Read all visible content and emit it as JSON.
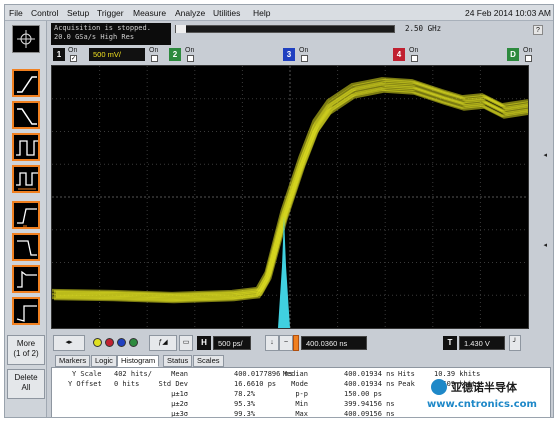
{
  "menu": [
    "File",
    "Control",
    "Setup",
    "Trigger",
    "Measure",
    "Analyze",
    "Utilities",
    "Help"
  ],
  "datetime": "24 Feb 2014 10:03 AM",
  "acquisition": {
    "status": "Acquisition is stopped.",
    "rate": "20.0 GSa/s   High Res"
  },
  "bandwidth": "2.50 GHz",
  "help": "?",
  "channels": {
    "ch1": {
      "num": "1",
      "on": "On",
      "scale": "500 mV/",
      "color": "#e8e020"
    },
    "ch2": {
      "num": "2",
      "on": "On",
      "color": "#30a040"
    },
    "ch3": {
      "num": "3",
      "on": "On",
      "color": "#2040c0"
    },
    "ch4": {
      "num": "4",
      "on": "On",
      "color": "#c02030"
    },
    "d": {
      "num": "D",
      "on": "On",
      "color": "#30a040"
    }
  },
  "left_toolbar": {
    "more": "More\n(1 of 2)",
    "delete": "Delete\nAll"
  },
  "timebase": {
    "h_label": "H",
    "h_value": "500 ps/",
    "delay_value": "400.0360 ns",
    "t_label": "T",
    "t_value": "1.430 V"
  },
  "tabs": [
    "Markers",
    "Logic",
    "Histogram",
    "Status",
    "Scales"
  ],
  "active_tab": "Histogram",
  "histogram": {
    "y_scale_label": "Y Scale",
    "y_scale_value": "402 hits/",
    "y_offset_label": "Y Offset",
    "y_offset_value": "0 hits",
    "rows": [
      {
        "label": "Mean",
        "value": "400.0177896 ns",
        "label2": "Median",
        "value2": "400.01934 ns",
        "label3": "Hits",
        "value3": "10.39 khits"
      },
      {
        "label": "Std Dev",
        "value": "16.6610 ps",
        "label2": "Mode",
        "value2": "400.01934 ns",
        "label3": "Peak",
        "value3": "1.609 khits"
      },
      {
        "label": "μ±1σ",
        "value": "78.2%",
        "label2": "p-p",
        "value2": "150.00 ps"
      },
      {
        "label": "μ±2σ",
        "value": "95.3%",
        "label2": "Min",
        "value2": "399.94156 ns"
      },
      {
        "label": "μ±3σ",
        "value": "99.3%",
        "label2": "Max",
        "value2": "400.09156 ns"
      }
    ]
  },
  "watermark": {
    "top": "亚德诺半导体",
    "bottom": "www.cntronics.com"
  },
  "colors": {
    "trace": "#e0e020",
    "histogram": "#40d0e0",
    "grid": "#3a3a3a"
  }
}
